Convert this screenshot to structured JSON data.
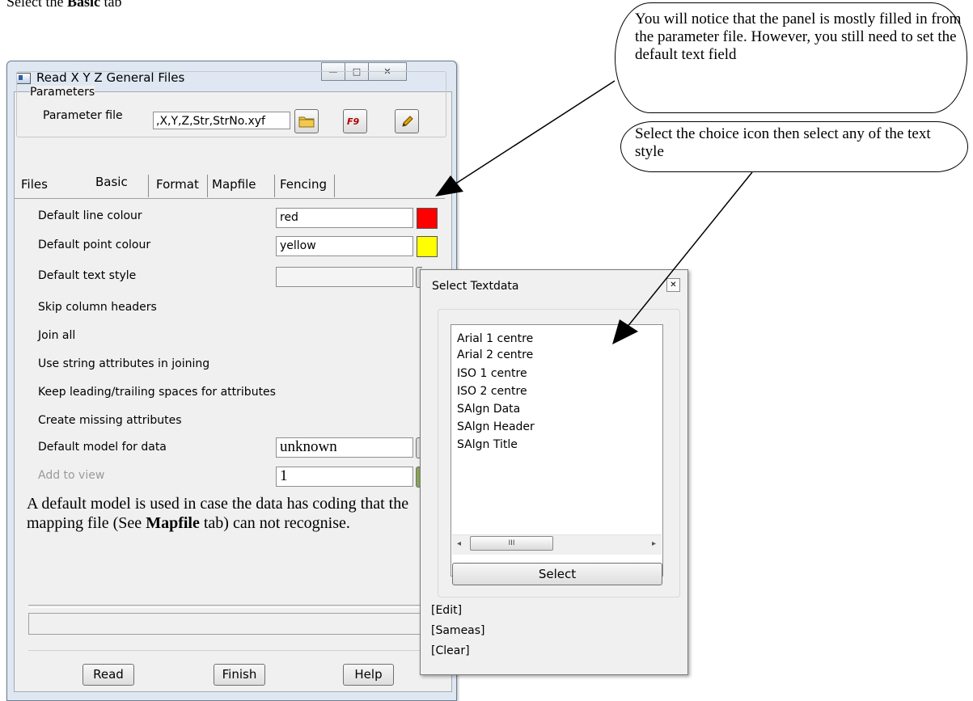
{
  "instruction": {
    "prefix": "Select the ",
    "bold": "Basic",
    "suffix": " tab"
  },
  "main_window": {
    "title": "Read X Y Z General Files",
    "minimize_glyph": "—",
    "maximize_glyph": "□",
    "close_glyph": "✕",
    "parameters_group_label": "Parameters",
    "parameter_file_label": "Parameter file",
    "parameter_file_value": ",X,Y,Z,Str,StrNo.xyf",
    "tabs": [
      "Files",
      "Basic",
      "Format",
      "Mapfile",
      "Fencing"
    ],
    "active_tab": "Basic",
    "rows": {
      "line_colour": {
        "label": "Default line colour",
        "value": "red",
        "swatch": "#ff0000"
      },
      "point_colour": {
        "label": "Default point colour",
        "value": "yellow",
        "swatch": "#ffff00"
      },
      "text_style": {
        "label": "Default text style",
        "value": ""
      },
      "skip_headers": {
        "label": "Skip column headers"
      },
      "join_all": {
        "label": "Join all"
      },
      "use_string_attrs": {
        "label": "Use string attributes in joining"
      },
      "keep_spaces": {
        "label": "Keep leading/trailing spaces for attributes"
      },
      "create_missing": {
        "label": "Create missing attributes"
      },
      "default_model": {
        "label": "Default model for data",
        "value": "unknown"
      },
      "add_to_view": {
        "label": "Add to view",
        "value": "1"
      }
    },
    "note": {
      "part1": "A default model is used in case the data has coding that the mapping file (See ",
      "bold": "Mapfile",
      "part2": " tab) can not recognise."
    },
    "buttons": {
      "read": "Read",
      "finish": "Finish",
      "help": "Help"
    }
  },
  "dialog": {
    "title": "Select Textdata",
    "close_glyph": "✕",
    "items": [
      "Arial 1 centre",
      "Arial 2 centre",
      "ISO 1 centre",
      "ISO 2 centre",
      "SAlgn Data",
      "SAlgn Header",
      "SAlgn Title"
    ],
    "scroll_thumb": "III",
    "select_button": "Select",
    "links": [
      "[Edit]",
      "[Sameas]",
      "[Clear]"
    ]
  },
  "callouts": {
    "panel_note": "You will notice that the panel is mostly filled in from the parameter file. However, you still need to set the default text field",
    "choice_note": "Select the choice icon then select any of the text style"
  },
  "colors": {
    "red": "#ff0000",
    "yellow": "#ffff00",
    "window_frame": "#dfe8f2",
    "panel": "#f0f0f0"
  }
}
